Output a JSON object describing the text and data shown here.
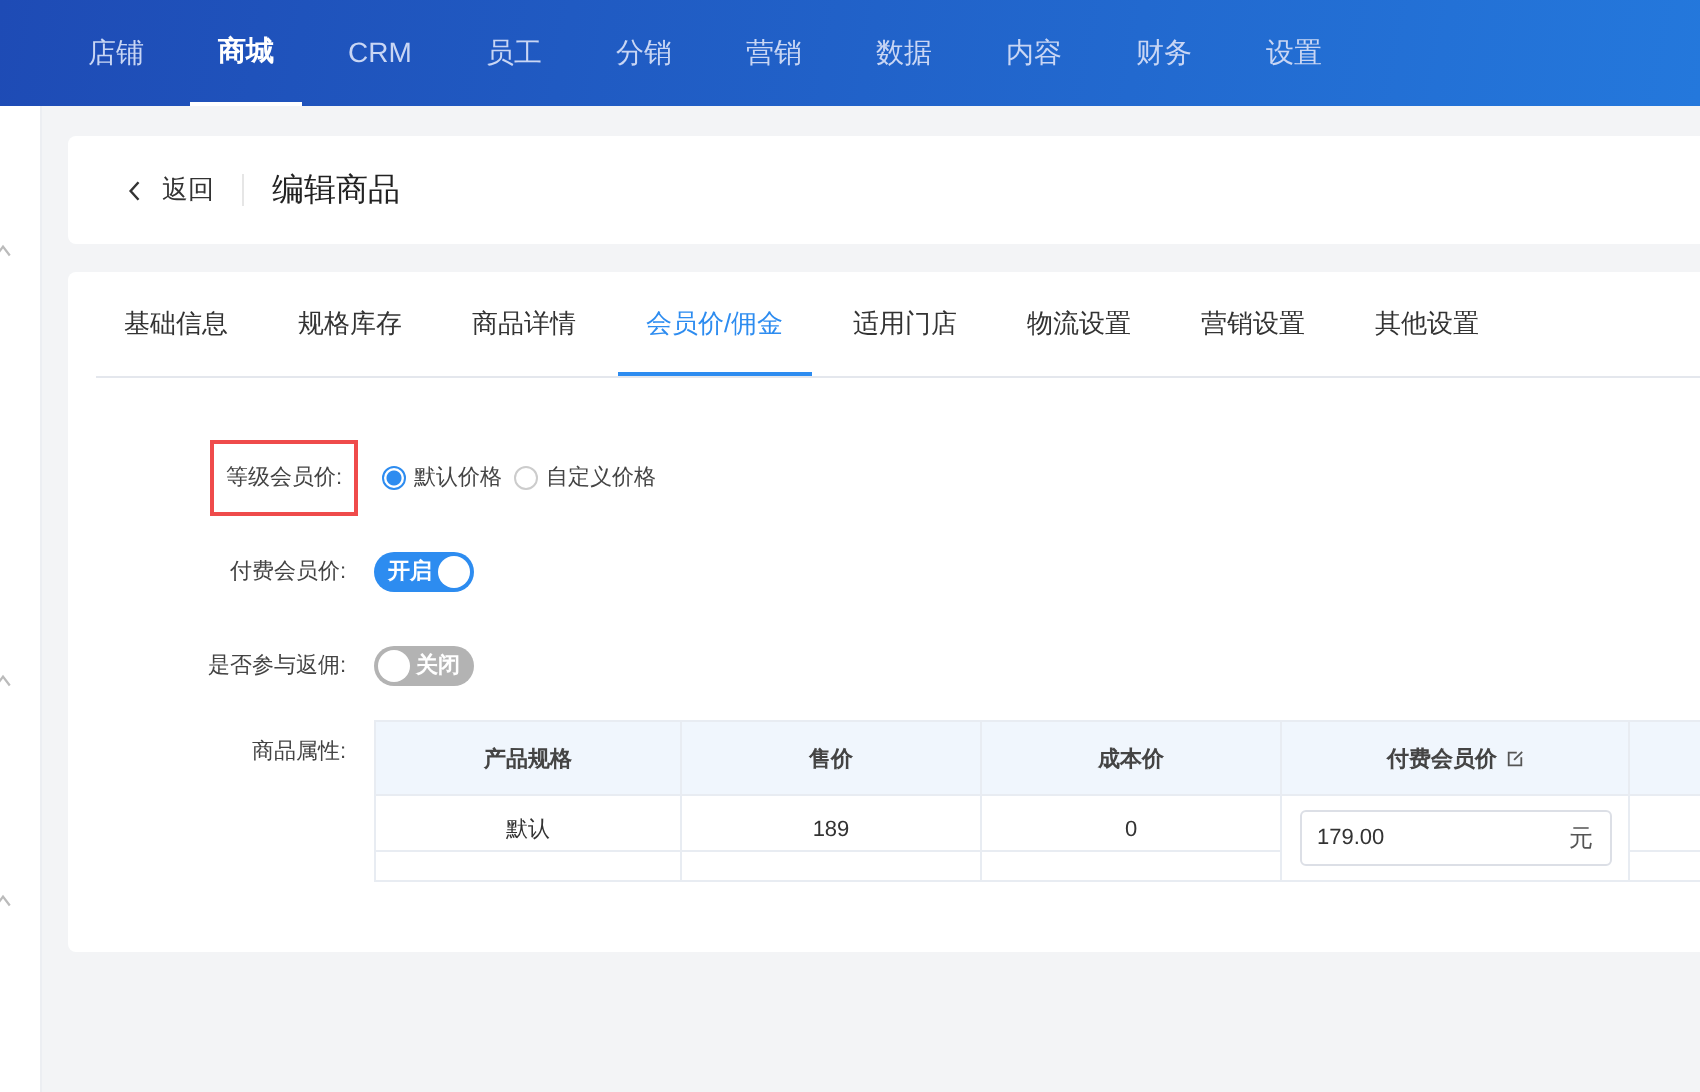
{
  "nav": [
    {
      "label": "店铺",
      "selected": false
    },
    {
      "label": "商城",
      "selected": true
    },
    {
      "label": "CRM",
      "selected": false
    },
    {
      "label": "员工",
      "selected": false
    },
    {
      "label": "分销",
      "selected": false
    },
    {
      "label": "营销",
      "selected": false
    },
    {
      "label": "数据",
      "selected": false
    },
    {
      "label": "内容",
      "selected": false
    },
    {
      "label": "财务",
      "selected": false
    },
    {
      "label": "设置",
      "selected": false
    }
  ],
  "header": {
    "back": "返回",
    "title": "编辑商品"
  },
  "tabs": [
    {
      "label": "基础信息",
      "selected": false
    },
    {
      "label": "规格库存",
      "selected": false
    },
    {
      "label": "商品详情",
      "selected": false
    },
    {
      "label": "会员价/佣金",
      "selected": true
    },
    {
      "label": "适用门店",
      "selected": false
    },
    {
      "label": "物流设置",
      "selected": false
    },
    {
      "label": "营销设置",
      "selected": false
    },
    {
      "label": "其他设置",
      "selected": false
    }
  ],
  "form": [
    {
      "kind": "radio",
      "label": "等级会员价:",
      "highlighted": true,
      "options": [
        {
          "label": "默认价格",
          "selected": true
        },
        {
          "label": "自定义价格",
          "selected": false
        }
      ]
    },
    {
      "kind": "switch",
      "label": "付费会员价:",
      "on": true,
      "text": "开启"
    },
    {
      "kind": "switch",
      "label": "是否参与返佣:",
      "on": false,
      "text": "关闭"
    },
    {
      "kind": "table",
      "label": "商品属性:",
      "columns": [
        {
          "title": "产品规格",
          "editable": false
        },
        {
          "title": "售价",
          "editable": false
        },
        {
          "title": "成本价",
          "editable": false
        },
        {
          "title": "付费会员价",
          "editable": true
        }
      ],
      "rows": [
        [
          {
            "kind": "text",
            "value": "默认"
          },
          {
            "kind": "text",
            "value": "189"
          },
          {
            "kind": "text",
            "value": "0"
          },
          {
            "kind": "input",
            "value": "179.00",
            "suffix": "元"
          }
        ]
      ]
    }
  ]
}
